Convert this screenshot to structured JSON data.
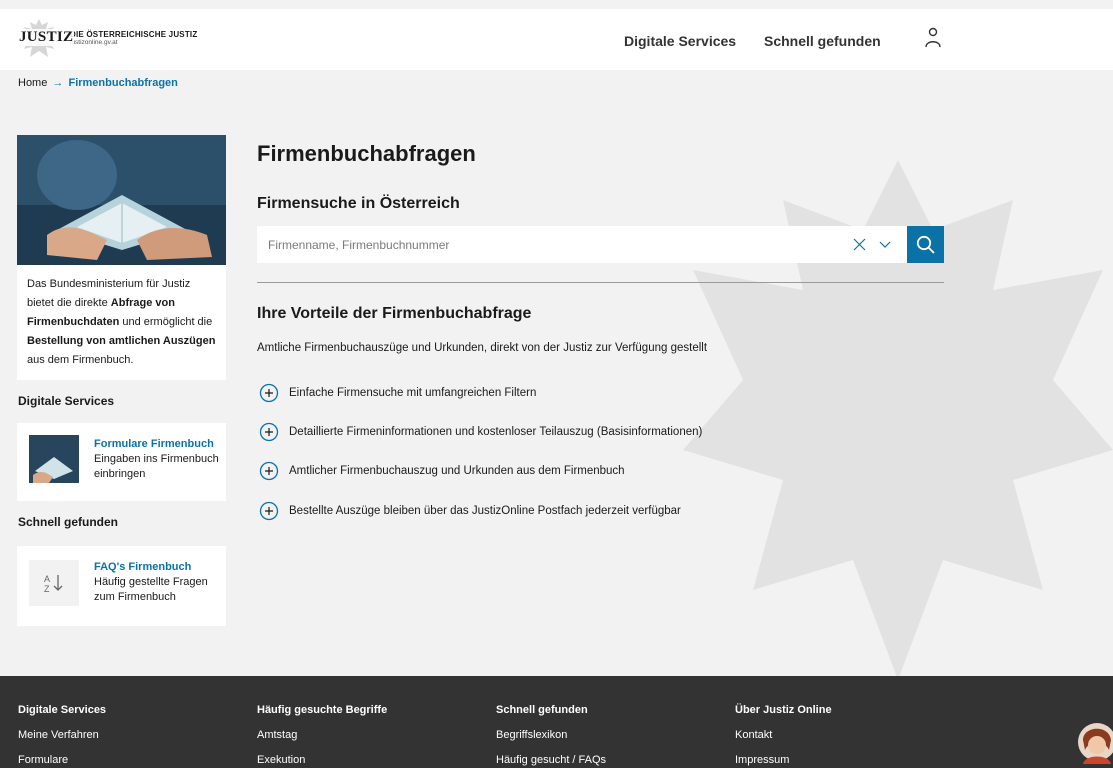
{
  "colors": {
    "accent": "#0b72a8",
    "footer_bg": "#333333",
    "page_bg": "#f2f2f2"
  },
  "header": {
    "logo_word": "JUSTIZ",
    "logo_title": "DIE ÖSTERREICHISCHE JUSTIZ",
    "logo_url": "justizonline.gv.at",
    "nav": [
      "Digitale Services",
      "Schnell gefunden"
    ],
    "user_icon": "user-icon"
  },
  "breadcrumb": {
    "home": "Home",
    "arrow": "→",
    "current": "Firmenbuchabfragen"
  },
  "sidebar": {
    "intro": {
      "t1": "Das Bundesministerium für Justiz bietet die direkte ",
      "b1": "Abfrage von Firmenbuchdaten",
      "t2": " und ermöglicht die ",
      "b2": "Bestellung von amtlichen Auszügen",
      "t3": " aus dem Firmenbuch."
    },
    "digital_heading": "Digitale Services",
    "digital_card": {
      "title": "Formulare Firmenbuch",
      "text": "Eingaben ins Firmenbuch einbringen"
    },
    "quick_heading": "Schnell gefunden",
    "quick_card": {
      "icon": "sort-az-icon",
      "title": "FAQ's Firmenbuch",
      "text": "Häufig gestellte Fragen zum Firmenbuch"
    }
  },
  "main": {
    "title": "Firmenbuchabfragen",
    "search_heading": "Firmensuche in Österreich",
    "search_placeholder": "Firmenname, Firmenbuchnummer",
    "advantages_heading": "Ihre Vorteile der Firmenbuchabfrage",
    "advantages_sub": "Amtliche Firmenbuchauszüge und Urkunden, direkt von der Justiz zur Verfügung gestellt",
    "features": [
      "Einfache Firmensuche mit umfangreichen Filtern",
      "Detaillierte Firmeninformationen und kostenloser Teilauszug (Basisinformationen)",
      "Amtlicher Firmenbuchauszug und Urkunden aus dem Firmenbuch",
      "Bestellte Auszüge bleiben über das JustizOnline Postfach jederzeit verfügbar"
    ]
  },
  "footer": {
    "cols": [
      {
        "heading": "Digitale Services",
        "links": [
          "Meine Verfahren",
          "Formulare"
        ]
      },
      {
        "heading": "Häufig gesuchte Begriffe",
        "links": [
          "Amtstag",
          "Exekution"
        ]
      },
      {
        "heading": "Schnell gefunden",
        "links": [
          "Begriffslexikon",
          "Häufig gesucht / FAQs"
        ]
      },
      {
        "heading": "Über Justiz Online",
        "links": [
          "Kontakt",
          "Impressum"
        ]
      }
    ]
  }
}
